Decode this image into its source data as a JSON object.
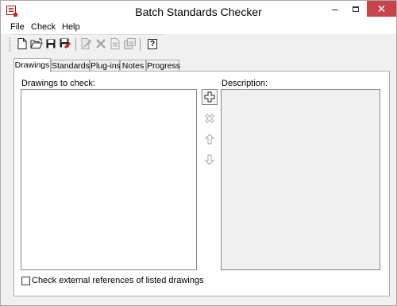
{
  "window": {
    "title": "Batch Standards Checker",
    "close_symbol": "✕"
  },
  "menu": {
    "items": [
      "File",
      "Check",
      "Help"
    ]
  },
  "toolbar": {
    "icons": [
      "new-icon",
      "open-icon",
      "save-icon",
      "save-as-icon",
      "check-icon",
      "delete-icon",
      "report-icon",
      "export-icon",
      "help-icon"
    ],
    "help_symbol": "?"
  },
  "tabs": [
    "Drawings",
    "Standards",
    "Plug-ins",
    "Notes",
    "Progress"
  ],
  "active_tab": "Drawings",
  "drawings_panel": {
    "drawings_label": "Drawings to check:",
    "description_label": "Description:",
    "add_symbol": "+",
    "remove_symbol": "✕"
  },
  "options": {
    "check_xrefs_label": "Check external references of listed drawings",
    "check_xrefs_checked": false
  },
  "colors": {
    "close_button": "#c7454a",
    "disabled_icon": "#a8a8a8",
    "window_bg": "#f0f0f0"
  }
}
